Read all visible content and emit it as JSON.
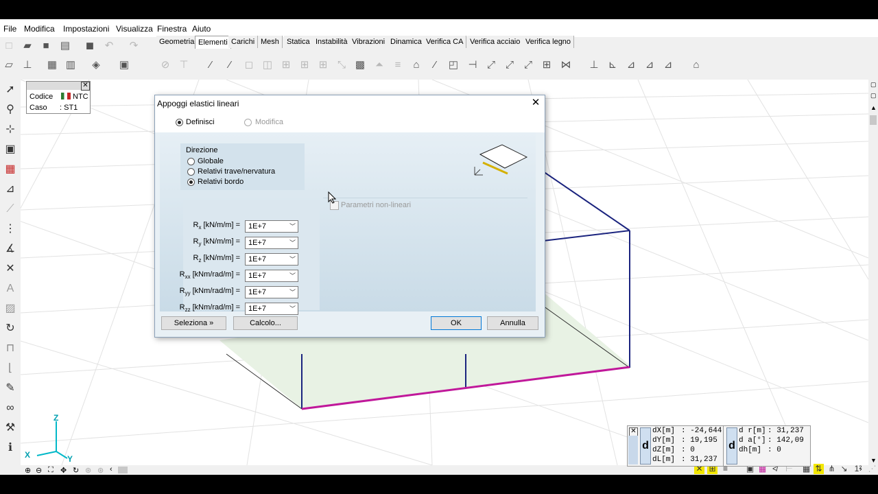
{
  "menu": [
    "File",
    "Modifica",
    "Impostazioni",
    "Visualizza",
    "Finestra",
    "Aiuto"
  ],
  "tabs": [
    "Geometria",
    "Elementi",
    "Carichi",
    "Mesh",
    "Statica",
    "Instabilità",
    "Vibrazioni",
    "Dinamica",
    "Verifica CA",
    "Verifica acciaio",
    "Verifica legno"
  ],
  "active_tab": "Elementi",
  "info": {
    "codice_label": "Codice",
    "codice_value": "NTC",
    "caso_label": "Caso",
    "caso_value": ": ST1"
  },
  "dialog": {
    "title": "Appoggi elastici lineari",
    "close": "✕",
    "mode_define": "Definisci",
    "mode_modify": "Modifica",
    "direction_title": "Direzione",
    "directions": [
      "Globale",
      "Relativi trave/nervatura",
      "Relativi bordo"
    ],
    "nonlinear_label": "Parametri non-lineari",
    "fields": [
      {
        "main": "R",
        "sub": "x",
        "unit": " [kN/m/m] =",
        "value": "1E+7"
      },
      {
        "main": "R",
        "sub": "y",
        "unit": " [kN/m/m] =",
        "value": "1E+7"
      },
      {
        "main": "R",
        "sub": "z",
        "unit": " [kN/m/m] =",
        "value": "1E+7"
      },
      {
        "main": "R",
        "sub": "xx",
        "unit": " [kNm/rad/m] =",
        "value": "1E+7"
      },
      {
        "main": "R",
        "sub": "yy",
        "unit": " [kNm/rad/m] =",
        "value": "1E+7"
      },
      {
        "main": "R",
        "sub": "zz",
        "unit": " [kNm/rad/m] =",
        "value": "1E+7"
      }
    ],
    "btn_select": "Seleziona »",
    "btn_calc": "Calcolo...",
    "btn_ok": "OK",
    "btn_cancel": "Annulla"
  },
  "axes": {
    "z": "Z",
    "x": "X",
    "y": "Y"
  },
  "coords_left": [
    {
      "k": "dX[m]",
      "v": ": -24,644"
    },
    {
      "k": "dY[m]",
      "v": ": 19,195"
    },
    {
      "k": "dZ[m]",
      "v": ": 0"
    },
    {
      "k": "dL[m]",
      "v": ": 31,237"
    }
  ],
  "coords_right": [
    {
      "k": "d r[m]",
      "v": ": 31,237"
    },
    {
      "k": "d a[°]",
      "v": ": 142,09"
    },
    {
      "k": "dh[m]",
      "v": ": 0"
    }
  ],
  "coord_d": "d",
  "coord_close": "✕",
  "status_right": "1²",
  "colors": {
    "accent": "#0078d7",
    "edge_blue": "#1a237e",
    "edge_magenta": "#c0189a",
    "floor": "#e8f2e4"
  }
}
